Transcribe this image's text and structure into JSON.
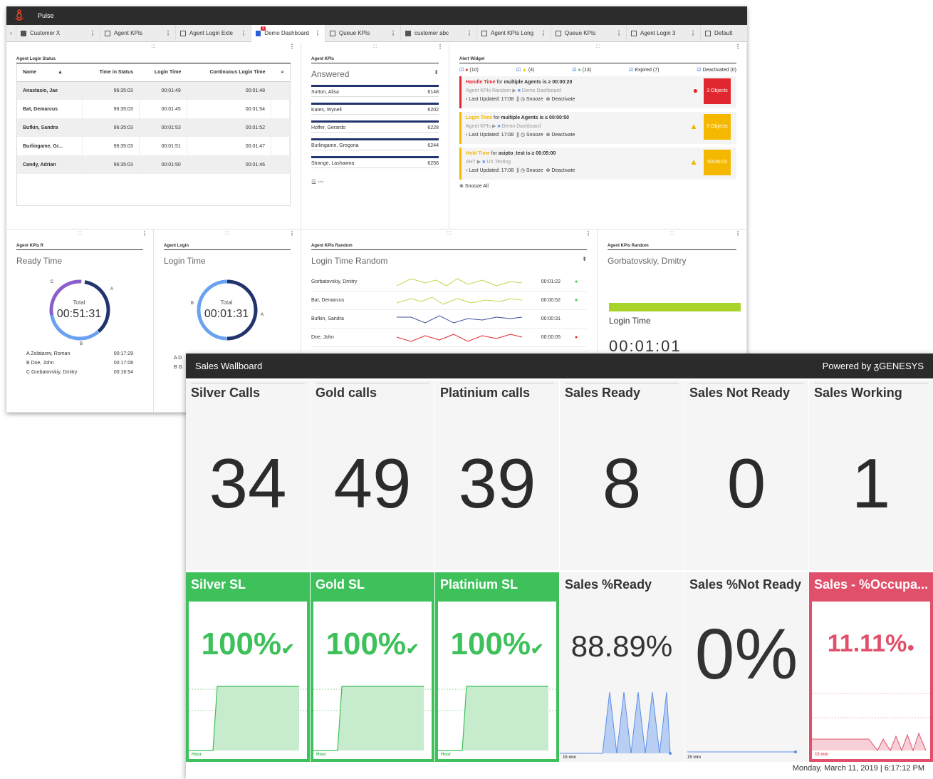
{
  "pulse": {
    "app_title": "Pulse",
    "tabs": [
      {
        "label": "Customer X"
      },
      {
        "label": "Agent KPIs"
      },
      {
        "label": "Agent Login Exte"
      },
      {
        "label": "Demo Dashboard"
      },
      {
        "label": "Queue KPIs"
      },
      {
        "label": "customer abc"
      },
      {
        "label": "Agent KPIs Long"
      },
      {
        "label": "Queue KPIs"
      },
      {
        "label": "Agent Login 3"
      },
      {
        "label": "Default"
      }
    ],
    "active_tab_badge": "3",
    "login_status": {
      "title": "Agent Login Status",
      "cols": [
        "Name",
        "Time in Status",
        "Login Time",
        "Continuous Login Time"
      ],
      "rows": [
        [
          "Anastasio, Jae",
          "96:35:03",
          "00:01:49",
          "00:01:48"
        ],
        [
          "Bat, Demarcus",
          "96:35:03",
          "00:01:45",
          "00:01:54"
        ],
        [
          "Bufkin, Sandra",
          "96:35:03",
          "00:01:53",
          "00:01:52"
        ],
        [
          "Burlingame, Gr...",
          "96:35:03",
          "00:01:51",
          "00:01:47"
        ],
        [
          "Candy, Adrian",
          "96:35:03",
          "00:01:50",
          "00:01:46"
        ]
      ]
    },
    "agent_kpis": {
      "title": "Agent KPIs",
      "select": "Answered",
      "items": [
        {
          "name": "Sutton, Alisa",
          "value": "6148"
        },
        {
          "name": "Kates, Wynell",
          "value": "6202"
        },
        {
          "name": "Hoffer, Gerardo",
          "value": "6228"
        },
        {
          "name": "Burlingame, Gregoria",
          "value": "6244"
        },
        {
          "name": "Strange, Lashawna",
          "value": "6256"
        }
      ]
    },
    "alerts": {
      "title": "Alert Widget",
      "filters": [
        {
          "label": "(10)"
        },
        {
          "label": "(4)"
        },
        {
          "label": "(13)"
        },
        {
          "label": "Expired (7)"
        },
        {
          "label": "Deactivated (0)"
        }
      ],
      "items": [
        {
          "metric": "Handle Time",
          "rest": " for ",
          "who": "multiple Agents",
          "cond": " is ≥ 00:00:20",
          "path1": "Agent KPIs Random",
          "path2": "Demo Dashboard",
          "updated": "Last Updated:  17:08",
          "box": "3 Objects",
          "color": "#e0262e"
        },
        {
          "metric": "Login Time",
          "rest": " for ",
          "who": "multiple Agents",
          "cond": " is ≤ 00:00:50",
          "path1": "Agent KPIs",
          "path2": "Demo Dashboard",
          "updated": "Last Updated:  17:08",
          "box": "5 Objects",
          "color": "#f5b800"
        },
        {
          "metric": "Hold Time",
          "rest": " for ",
          "who": "asipto_test",
          "cond": " is ≥ 00:05:00",
          "path1": "AHT",
          "path2": "UX Testing",
          "updated": "Last Updated:  17:08",
          "box": "00:06:03",
          "color": "#f5b800"
        }
      ],
      "snooze": "Snooze",
      "deactivate": "Deactivate",
      "snooze_all": "Snooze All"
    },
    "kpi_r": {
      "title": "Agent KPIs R",
      "subtitle": "Ready Time",
      "total_label": "Total",
      "total": "00:51:31",
      "legend": [
        [
          "A  Zolatarev, Roman",
          "00:17:29"
        ],
        [
          "B  Doe, John",
          "00:17:08"
        ],
        [
          "C  Gorbatovskiy, Dmitry",
          "00:16:54"
        ]
      ]
    },
    "login": {
      "title": "Agent Login",
      "subtitle": "Login Time",
      "total_label": "Total",
      "total": "00:01:31",
      "legend": [
        [
          "A  D",
          ""
        ],
        [
          "B  G",
          ""
        ]
      ]
    },
    "random": {
      "title": "Agent KPIs Random",
      "select": "Login Time Random",
      "rows": [
        [
          "Gorbatovskiy, Dmitry",
          "00:01:22",
          "ok"
        ],
        [
          "Bat, Demarcus",
          "00:00:52",
          "ok"
        ],
        [
          "Bufkin, Sandra",
          "00:00:31",
          ""
        ],
        [
          "Doe, John",
          "00:00:05",
          "err"
        ]
      ]
    },
    "random2": {
      "title": "Agent KPIs Random",
      "name": "Gorbatovskiy, Dmitry",
      "metric": "Login Time",
      "value": "00:01:01"
    }
  },
  "wall": {
    "title": "Sales Wallboard",
    "powered": "Powered by",
    "brand": "GENESYS",
    "footer": "Monday, March 11, 2019 | 6:17:12 PM",
    "top": [
      {
        "label": "Silver Calls",
        "value": "34"
      },
      {
        "label": "Gold calls",
        "value": "49"
      },
      {
        "label": "Platinium calls",
        "value": "39"
      },
      {
        "label": "Sales Ready",
        "value": "8"
      },
      {
        "label": "Sales Not Ready",
        "value": "0"
      },
      {
        "label": "Sales Working",
        "value": "1"
      }
    ],
    "bottom": [
      {
        "label": "Silver SL",
        "value": "100%",
        "axis": "Hour"
      },
      {
        "label": "Gold SL",
        "value": "100%",
        "axis": "Hour"
      },
      {
        "label": "Platinium SL",
        "value": "100%",
        "axis": "Hour"
      },
      {
        "label": "Sales %Ready",
        "value": "88.89%",
        "axis": "15 min"
      },
      {
        "label": "Sales %Not Ready",
        "value": "0%",
        "axis": "15 min"
      },
      {
        "label": "Sales - %Occupa...",
        "value": "11.11%",
        "axis": "15 min"
      }
    ]
  }
}
